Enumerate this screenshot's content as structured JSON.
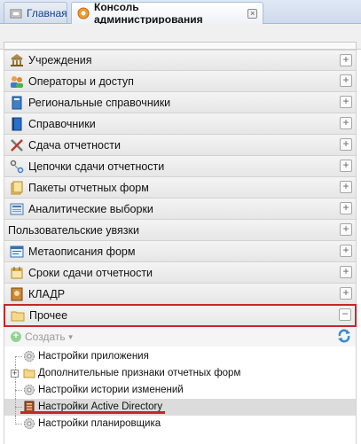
{
  "tabs": [
    {
      "label": "Главная",
      "icon": "home-icon"
    },
    {
      "label": "Консоль администрирования",
      "icon": "gear-icon",
      "closable": true
    }
  ],
  "accordion": [
    {
      "label": "Учреждения",
      "icon": "institution-icon"
    },
    {
      "label": "Операторы и доступ",
      "icon": "users-icon"
    },
    {
      "label": "Региональные справочники",
      "icon": "book-icon"
    },
    {
      "label": "Справочники",
      "icon": "book-blue-icon"
    },
    {
      "label": "Сдача отчетности",
      "icon": "tools-icon"
    },
    {
      "label": "Цепочки сдачи отчетности",
      "icon": "chain-icon"
    },
    {
      "label": "Пакеты отчетных форм",
      "icon": "package-icon"
    },
    {
      "label": "Аналитические выборки",
      "icon": "analytics-icon"
    },
    {
      "label": "Пользовательские увязки",
      "icon": ""
    },
    {
      "label": "Метаописания форм",
      "icon": "form-icon"
    },
    {
      "label": "Сроки сдачи отчетности",
      "icon": "calendar-icon"
    },
    {
      "label": "КЛАДР",
      "icon": "address-book-icon"
    },
    {
      "label": "Прочее",
      "icon": "folder-icon",
      "open": true
    }
  ],
  "toolbar": {
    "create_label": "Создать"
  },
  "tree": [
    {
      "label": "Настройки приложения",
      "icon": "gear-icon",
      "expandable": false
    },
    {
      "label": "Дополнительные признаки отчетных форм",
      "icon": "folder-icon",
      "expandable": true
    },
    {
      "label": "Настройки истории изменений",
      "icon": "gear-icon",
      "expandable": false
    },
    {
      "label": "Настройки Active Directory",
      "icon": "ad-icon",
      "expandable": false,
      "selected": true
    },
    {
      "label": "Настройки планировщика",
      "icon": "gear-icon",
      "expandable": false
    }
  ],
  "colors": {
    "highlight": "#c3272b",
    "tab_text": "#15428b"
  }
}
